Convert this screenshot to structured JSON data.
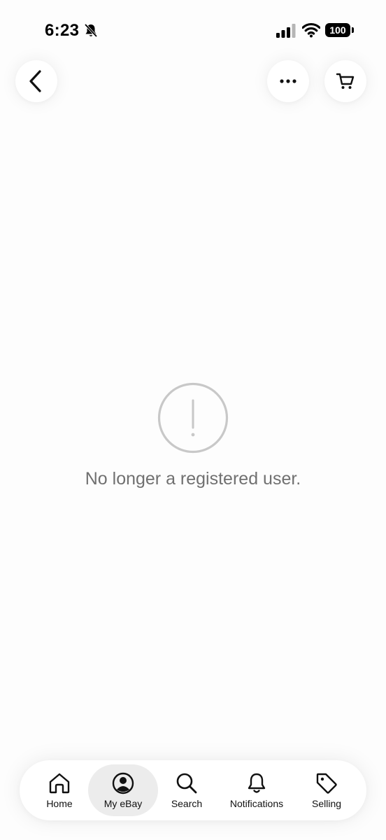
{
  "status_bar": {
    "time": "6:23",
    "battery_level": "100",
    "icons": [
      "bell-slash-icon",
      "signal-icon",
      "wifi-icon",
      "battery-icon"
    ]
  },
  "header": {
    "back_icon": "chevron-left-icon",
    "more_icon": "more-horizontal-icon",
    "cart_icon": "cart-icon"
  },
  "main": {
    "alert_icon": "alert-circle-icon",
    "message": "No longer a registered user."
  },
  "tab_bar": {
    "active": "My eBay",
    "tabs": [
      {
        "label": "Home",
        "icon": "home-icon"
      },
      {
        "label": "My eBay",
        "icon": "user-circle-icon"
      },
      {
        "label": "Search",
        "icon": "search-icon"
      },
      {
        "label": "Notifications",
        "icon": "bell-icon"
      },
      {
        "label": "Selling",
        "icon": "tag-icon"
      }
    ]
  },
  "colors": {
    "background": "#fdfdfd",
    "message_text": "#707070",
    "alert_icon": "#c8c8c8",
    "active_tab_bg": "#ececec"
  }
}
